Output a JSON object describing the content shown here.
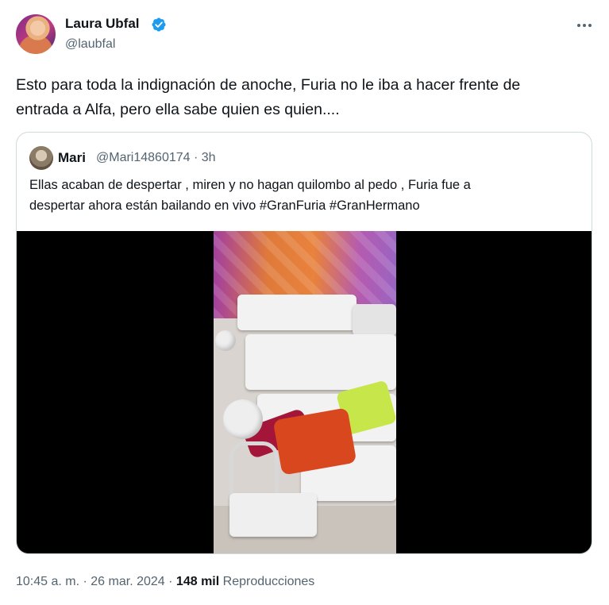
{
  "tweet": {
    "author_name": "Laura Ubfal",
    "author_handle": "@laubfal",
    "text_line1": "Esto para toda la indignación de anoche, Furia no le iba a hacer frente de",
    "text_line2": "entrada a Alfa, pero ella sabe quien es quien...."
  },
  "quote": {
    "name": "Mari",
    "handle": "@Mari14860174",
    "separator": "·",
    "time": "3h",
    "text_line1": "Ellas acaban de despertar , miren y no hagan quilombo al pedo , Furia fue a",
    "text_line2": "despertar ahora están bailando en vivo #GranFuria #GranHermano"
  },
  "footer": {
    "time": "10:45 a. m.",
    "sep1": "·",
    "date": "26 mar. 2024",
    "sep2": "·",
    "views_count": "148 mil",
    "views_label": "Reproducciones"
  },
  "icons": {
    "verified": "verified-badge-icon",
    "more": "more-options-icon"
  },
  "colors": {
    "verified_blue": "#1d9bf0",
    "secondary_text": "#536471",
    "primary_text": "#0f1419",
    "border": "#cfd9de"
  }
}
